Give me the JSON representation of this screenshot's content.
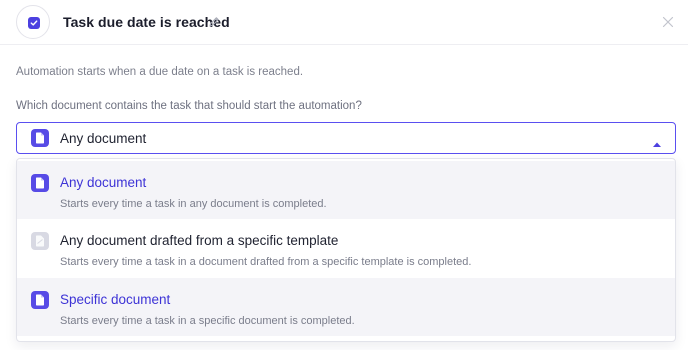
{
  "header": {
    "title": "Task due date is reached",
    "checkbox_checked": true,
    "icons": {
      "trigger": "checkbox-icon",
      "edit": "pencil-icon",
      "close": "close-icon"
    }
  },
  "description": "Automation starts when a due date on a task is reached.",
  "field": {
    "label": "Which document contains the task that should start the automation?",
    "selected_value": "Any document",
    "expanded": true,
    "icons": {
      "value": "document-icon",
      "toggle": "caret-up-icon"
    }
  },
  "options": [
    {
      "title": "Any document",
      "description": "Starts every time a task in any document is completed.",
      "icon": "document-icon",
      "selected": true
    },
    {
      "title": "Any document drafted from a specific template",
      "description": "Starts every time a task in a document drafted from a specific template is completed.",
      "icon": "template-document-icon",
      "disabled_icon": true
    },
    {
      "title": "Specific document",
      "description": "Starts every time a task in a specific document is completed.",
      "icon": "document-icon",
      "accent": true
    }
  ],
  "colors": {
    "accent": "#574be6",
    "accent_text": "#3d33d6",
    "border_focus": "#5a4ff0",
    "muted_text": "#7a7d8b",
    "option_hover_bg": "#f4f4f8",
    "disabled_icon_bg": "#d8d9e3"
  }
}
